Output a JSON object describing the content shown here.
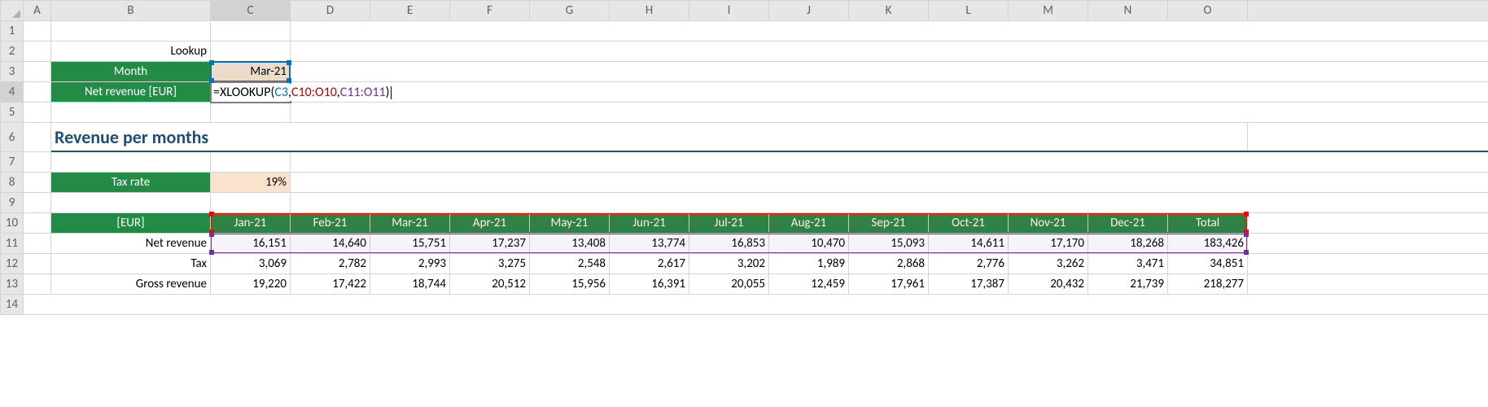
{
  "columns": [
    "A",
    "B",
    "C",
    "D",
    "E",
    "F",
    "G",
    "H",
    "I",
    "J",
    "K",
    "L",
    "M",
    "N",
    "O"
  ],
  "rows": [
    "1",
    "2",
    "3",
    "4",
    "5",
    "6",
    "7",
    "8",
    "9",
    "10",
    "11",
    "12",
    "13",
    "14"
  ],
  "B2": "Lookup",
  "B3": "Month",
  "C3": "Mar-21",
  "B4": "Net revenue [EUR]",
  "formula": {
    "prefix": "=XLOOKUP(",
    "arg1": "C3",
    "sep1": ",",
    "arg2": "C10:O10",
    "sep2": ",",
    "arg3": "C11:O11",
    "suffix": ")"
  },
  "B6_title": "Revenue per months",
  "B8": "Tax rate",
  "C8": "19%",
  "row10_label": "[EUR]",
  "row10": [
    "Jan-21",
    "Feb-21",
    "Mar-21",
    "Apr-21",
    "May-21",
    "Jun-21",
    "Jul-21",
    "Aug-21",
    "Sep-21",
    "Oct-21",
    "Nov-21",
    "Dec-21",
    "Total"
  ],
  "row11_label": "Net revenue",
  "row11": [
    "16,151",
    "14,640",
    "15,751",
    "17,237",
    "13,408",
    "13,774",
    "16,853",
    "10,470",
    "15,093",
    "14,611",
    "17,170",
    "18,268",
    "183,426"
  ],
  "row12_label": "Tax",
  "row12": [
    "3,069",
    "2,782",
    "2,993",
    "3,275",
    "2,548",
    "2,617",
    "3,202",
    "1,989",
    "2,868",
    "2,776",
    "3,262",
    "3,471",
    "34,851"
  ],
  "row13_label": "Gross revenue",
  "row13": [
    "19,220",
    "17,422",
    "18,744",
    "20,512",
    "15,956",
    "16,391",
    "20,055",
    "12,459",
    "17,961",
    "17,387",
    "20,432",
    "21,739",
    "218,277"
  ],
  "chart_data": {
    "type": "table",
    "title": "Revenue per months",
    "columns": [
      "Jan-21",
      "Feb-21",
      "Mar-21",
      "Apr-21",
      "May-21",
      "Jun-21",
      "Jul-21",
      "Aug-21",
      "Sep-21",
      "Oct-21",
      "Nov-21",
      "Dec-21",
      "Total"
    ],
    "rows": [
      {
        "name": "Net revenue",
        "values": [
          16151,
          14640,
          15751,
          17237,
          13408,
          13774,
          16853,
          10470,
          15093,
          14611,
          17170,
          18268,
          183426
        ]
      },
      {
        "name": "Tax",
        "values": [
          3069,
          2782,
          2993,
          3275,
          2548,
          2617,
          3202,
          1989,
          2868,
          2776,
          3262,
          3471,
          34851
        ]
      },
      {
        "name": "Gross revenue",
        "values": [
          19220,
          17422,
          18744,
          20512,
          15956,
          16391,
          20055,
          12459,
          17961,
          17387,
          20432,
          21739,
          218277
        ]
      }
    ],
    "currency": "EUR",
    "tax_rate": 0.19,
    "lookup": {
      "month": "Mar-21",
      "metric": "Net revenue [EUR]",
      "formula": "=XLOOKUP(C3,C10:O10,C11:O11)"
    }
  }
}
